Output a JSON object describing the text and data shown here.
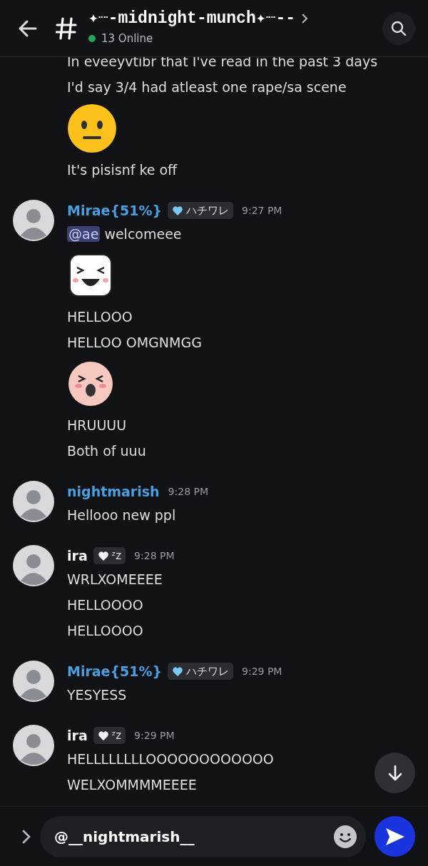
{
  "header": {
    "channel_name": "✦┈-midnight-munch✦┈--",
    "online_count": "13 Online"
  },
  "messages": [
    {
      "lines": [
        {
          "kind": "text",
          "text": "In eveeyvtibr that I've read in the past 3 days"
        },
        {
          "kind": "text",
          "text": "I'd say 3/4 had atleast one rape/sa scene"
        },
        {
          "kind": "emoji"
        },
        {
          "kind": "text",
          "text": "It's pisisnf ke off"
        }
      ]
    },
    {
      "author": {
        "name": "Mirae{51%}",
        "color": "#4a9fe0",
        "badge": {
          "text": "ハチワレ",
          "color": "#7cc8f5"
        },
        "time": "9:27 PM"
      },
      "lines": [
        {
          "kind": "text",
          "mention": "@ae",
          "text": "welcomeee"
        },
        {
          "kind": "laughing"
        },
        {
          "kind": "text",
          "text": "HELLOOO"
        },
        {
          "kind": "text",
          "text": "HELLOO OMGNMGG"
        },
        {
          "kind": "crying"
        },
        {
          "kind": "text",
          "text": "HRUUUU"
        },
        {
          "kind": "text",
          "text": "Both of uuu"
        }
      ]
    },
    {
      "author": {
        "name": "nightmarish",
        "color": "#4a9fe0",
        "time": "9:28 PM"
      },
      "lines": [
        {
          "kind": "text",
          "text": "Hellooo new ppl"
        }
      ]
    },
    {
      "author": {
        "name": "ira",
        "color": "#f2f3f5",
        "badge": {
          "text": "ᶻz",
          "color": "#f2f3f5"
        },
        "time": "9:28 PM"
      },
      "lines": [
        {
          "kind": "text",
          "text": "WRLXOMEEEE"
        },
        {
          "kind": "text",
          "text": "HELLOOOO"
        },
        {
          "kind": "text",
          "text": "HELLOOOO"
        }
      ]
    },
    {
      "author": {
        "name": "Mirae{51%}",
        "color": "#4a9fe0",
        "badge": {
          "text": "ハチワレ",
          "color": "#7cc8f5"
        },
        "time": "9:29 PM"
      },
      "lines": [
        {
          "kind": "text",
          "text": "YESYESS"
        }
      ]
    },
    {
      "author": {
        "name": "ira",
        "color": "#f2f3f5",
        "badge": {
          "text": "ᶻz",
          "color": "#f2f3f5"
        },
        "time": "9:29 PM"
      },
      "lines": [
        {
          "kind": "text",
          "text": "HELLLLLLLLOOOOOOOOOOOO"
        },
        {
          "kind": "text",
          "text": "WELXOMMMMEEEE"
        }
      ]
    }
  ],
  "composer": {
    "value": "@__nightmarish__"
  }
}
